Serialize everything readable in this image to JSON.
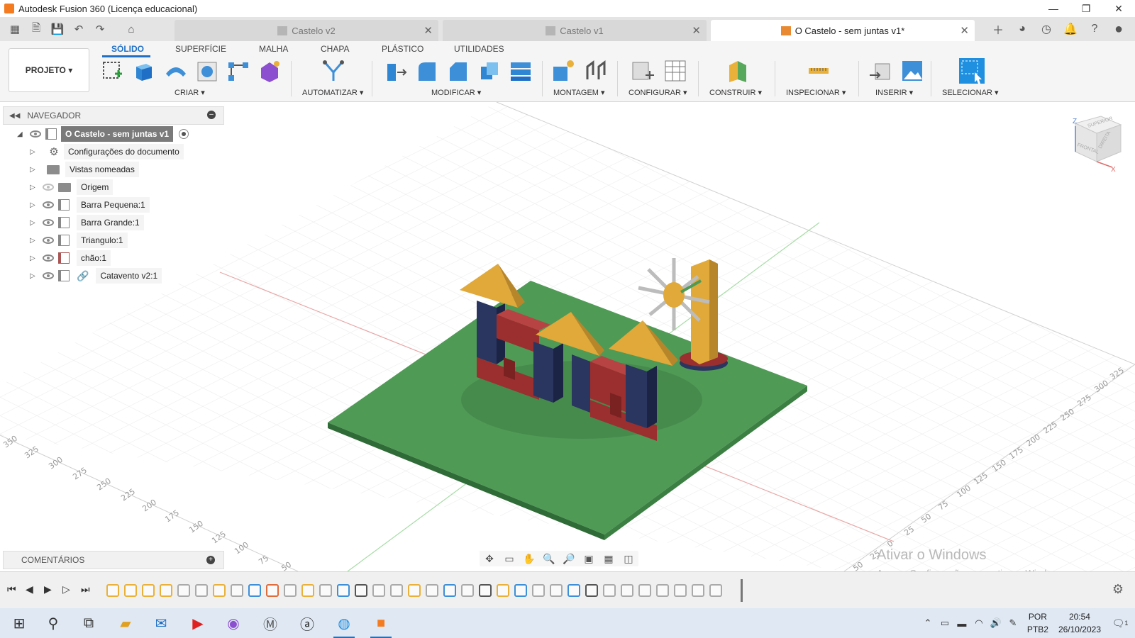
{
  "window": {
    "title": "Autodesk Fusion 360 (Licença educacional)",
    "controls": [
      "—",
      "❐",
      "✕"
    ]
  },
  "doc_tabs": [
    {
      "label": "Castelo v2",
      "active": false
    },
    {
      "label": "Castelo v1",
      "active": false
    },
    {
      "label": "O Castelo - sem juntas v1*",
      "active": true
    }
  ],
  "ribbon": {
    "project_label": "PROJETO ▾",
    "tabs": [
      "SÓLIDO",
      "SUPERFÍCIE",
      "MALHA",
      "CHAPA",
      "PLÁSTICO",
      "UTILIDADES"
    ],
    "groups": [
      "CRIAR ▾",
      "AUTOMATIZAR ▾",
      "MODIFICAR ▾",
      "MONTAGEM ▾",
      "CONFIGURAR ▾",
      "CONSTRUIR ▾",
      "INSPECIONAR ▾",
      "INSERIR ▾",
      "SELECIONAR ▾"
    ]
  },
  "navigator": {
    "title": "NAVEGADOR",
    "root": "O Castelo - sem juntas v1",
    "items": [
      {
        "label": "Configurações do documento",
        "icon": "gear-icon"
      },
      {
        "label": "Vistas nomeadas",
        "icon": "folder-icon"
      },
      {
        "label": "Origem",
        "icon": "folder-icon"
      },
      {
        "label": "Barra Pequena:1",
        "icon": "component-icon"
      },
      {
        "label": "Barra Grande:1",
        "icon": "component-icon"
      },
      {
        "label": "Triangulo:1",
        "icon": "component-icon"
      },
      {
        "label": "chão:1",
        "icon": "component-icon"
      },
      {
        "label": "Catavento v2:1",
        "icon": "component-icon"
      }
    ]
  },
  "comments": {
    "title": "COMENTÁRIOS"
  },
  "viewcube": {
    "top": "SUPERIOR",
    "front": "FRONTAL",
    "right": "DIREITA",
    "axis_z": "Z",
    "axis_x": "X"
  },
  "grid_labels": {
    "left": [
      "350",
      "325",
      "300",
      "275",
      "250",
      "225",
      "200",
      "175",
      "150",
      "125",
      "100",
      "75",
      "50"
    ],
    "right": [
      "325",
      "300",
      "275",
      "250",
      "225",
      "200",
      "175",
      "150",
      "125",
      "100",
      "75",
      "50",
      "25",
      "0",
      "25",
      "50"
    ]
  },
  "watermark": {
    "line1": "Ativar o Windows",
    "line2": "Acesse Configurações para ativar o Windows."
  },
  "taskbar": {
    "lang1": "POR",
    "lang2": "PTB2",
    "time": "20:54",
    "date": "26/10/2023",
    "notifications": "1"
  },
  "colors": {
    "accent": "#1f6fc6",
    "ground": "#4f9a55",
    "block_red": "#9b2f2f",
    "block_blue": "#2a3560",
    "roof": "#e0a93a",
    "fusion_orange": "#f47b20"
  }
}
